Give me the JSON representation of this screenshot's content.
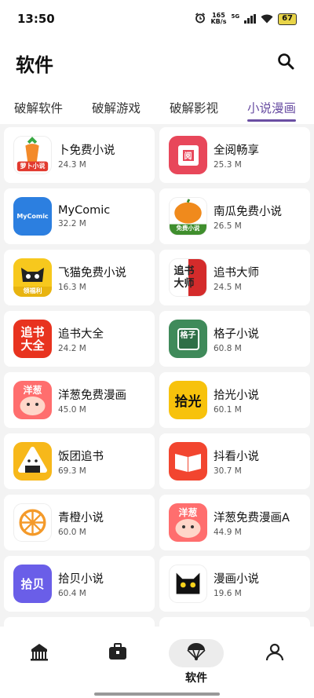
{
  "status_bar": {
    "time": "13:50",
    "net_speed_value": "165",
    "net_speed_unit": "KB/s",
    "network": "5G",
    "battery": "67"
  },
  "header": {
    "title": "软件"
  },
  "tabs": [
    {
      "label": "破解软件",
      "active": false
    },
    {
      "label": "破解游戏",
      "active": false
    },
    {
      "label": "破解影视",
      "active": false
    },
    {
      "label": "小说漫画",
      "active": true
    }
  ],
  "apps": [
    {
      "name": "卜免费小说",
      "size": "24.3 M",
      "icon_label": "萝卜小说"
    },
    {
      "name": "全阅畅享",
      "size": "25.3 M",
      "icon_label": "阅"
    },
    {
      "name": "MyComic",
      "size": "32.2 M",
      "icon_label": "MyComic"
    },
    {
      "name": "南瓜免费小说",
      "size": "26.5 M",
      "icon_label": "免费小说"
    },
    {
      "name": "飞猫免费小说",
      "size": "16.3 M",
      "icon_label": "领福利"
    },
    {
      "name": "追书大师",
      "size": "24.5 M",
      "icon_label": "追书大师"
    },
    {
      "name": "追书大全",
      "size": "24.2 M",
      "icon_label": "追书大全"
    },
    {
      "name": "格子小说",
      "size": "60.8 M",
      "icon_label": "格子"
    },
    {
      "name": "洋葱免费漫画",
      "size": "45.0 M",
      "icon_label": "洋葱"
    },
    {
      "name": "拾光小说",
      "size": "60.1 M",
      "icon_label": "拾光"
    },
    {
      "name": "饭团追书",
      "size": "69.3 M",
      "icon_label": ""
    },
    {
      "name": "抖看小说",
      "size": "30.7 M",
      "icon_label": ""
    },
    {
      "name": "青橙小说",
      "size": "60.0 M",
      "icon_label": ""
    },
    {
      "name": "洋葱免费漫画A",
      "size": "44.9 M",
      "icon_label": "洋葱"
    },
    {
      "name": "拾贝小说",
      "size": "60.4 M",
      "icon_label": "拾贝"
    },
    {
      "name": "漫画小说",
      "size": "19.6 M",
      "icon_label": ""
    }
  ],
  "bottom_nav": [
    {
      "icon": "carousel-icon",
      "label": "",
      "active": false
    },
    {
      "icon": "toolbox-icon",
      "label": "",
      "active": false
    },
    {
      "icon": "parachute-icon",
      "label": "软件",
      "active": true
    },
    {
      "icon": "user-icon",
      "label": "",
      "active": false
    }
  ],
  "colors": {
    "accent": "#6a4fa3",
    "background": "#f3f3f3"
  }
}
